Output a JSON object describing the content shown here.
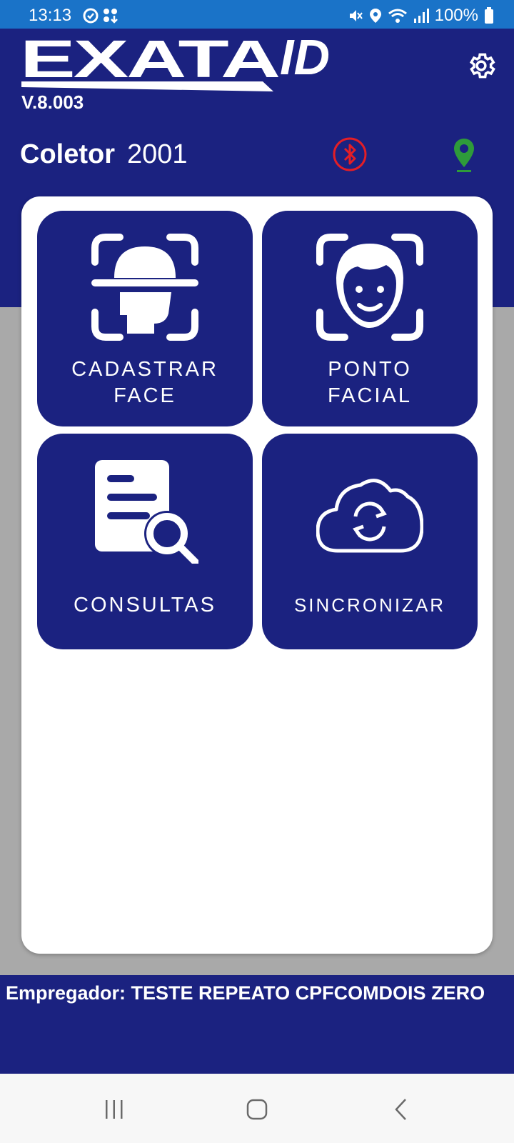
{
  "status_bar": {
    "time": "13:13",
    "battery": "100%",
    "icons": [
      "sync-icon",
      "apps-icon",
      "mute-icon",
      "location-icon",
      "wifi-icon",
      "signal-icon",
      "battery-icon"
    ]
  },
  "header": {
    "logo_text": "EXATA",
    "logo_suffix": "ID",
    "version": "V.8.003",
    "collector_label": "Coletor",
    "collector_value": "2001",
    "bluetooth_status_color": "#e41e26",
    "location_status_color": "#2e9b3a"
  },
  "tiles": [
    {
      "line1": "CADASTRAR",
      "line2": "FACE",
      "icon": "face-scan-icon"
    },
    {
      "line1": "PONTO",
      "line2": "FACIAL",
      "icon": "face-recognition-icon"
    },
    {
      "line1": "CONSULTAS",
      "line2": "",
      "icon": "document-search-icon"
    },
    {
      "line1": "SINCRONIZAR",
      "line2": "",
      "icon": "cloud-sync-icon"
    }
  ],
  "footer": {
    "employer": "Empregador: TESTE REPEATO CPFCOMDOIS ZERO"
  },
  "colors": {
    "primary": "#1b2280",
    "status_bar": "#1a73c8",
    "background": "#a9a9a9"
  }
}
